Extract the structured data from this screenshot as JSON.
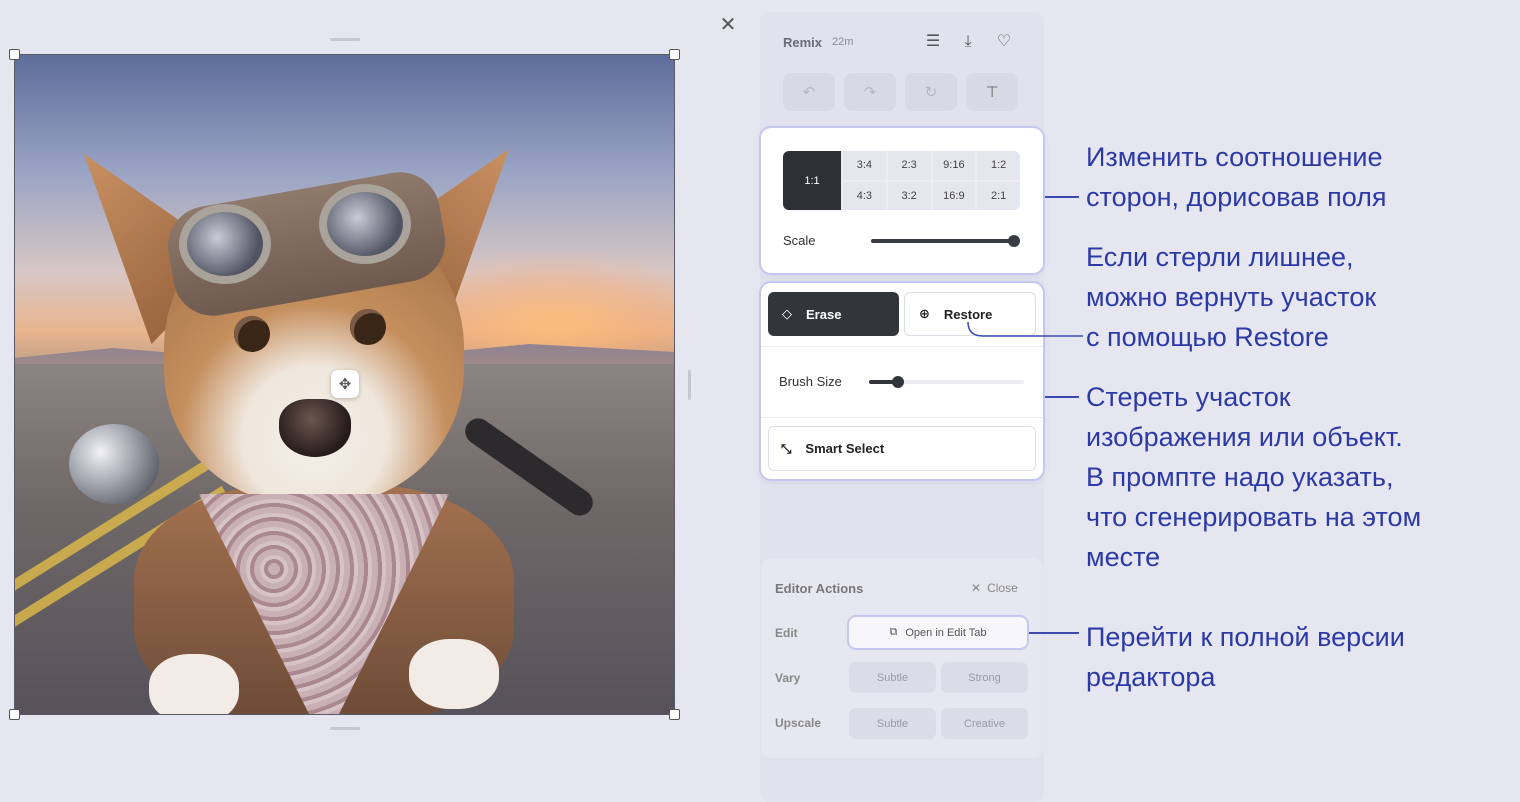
{
  "panel": {
    "title": "Remix",
    "time": "22m"
  },
  "icons": {
    "menu": "menu-lines-icon",
    "download": "download-icon",
    "favorite": "heart-icon",
    "undo": "undo-icon",
    "redo": "redo-icon",
    "reset": "refresh-icon",
    "text": "text-box-icon",
    "close": "close-icon",
    "move": "move-arrows-icon",
    "eraser": "eraser-icon",
    "restore": "plus-circle-icon",
    "smart": "magic-cursor-icon",
    "external": "external-link-icon"
  },
  "aspect": {
    "selected": "1:1",
    "options": [
      "3:4",
      "2:3",
      "9:16",
      "1:2",
      "4:3",
      "3:2",
      "16:9",
      "2:1"
    ],
    "scale_label": "Scale",
    "scale_value": 1.0
  },
  "erase": {
    "erase_label": "Erase",
    "restore_label": "Restore",
    "brush_label": "Brush Size",
    "brush_value": 0.17,
    "smart_label": "Smart Select"
  },
  "actions": {
    "title": "Editor Actions",
    "close_label": "Close",
    "edit_label": "Edit",
    "open_edit_label": "Open in Edit Tab",
    "vary_label": "Vary",
    "upscale_label": "Upscale",
    "subtle": "Subtle",
    "strong": "Strong",
    "creative": "Creative"
  },
  "annotations": {
    "aspect": "Изменить соотношение\nсторон, дорисовав поля",
    "restore": "Если стерли лишнее,\nможно вернуть участок\nс помощью Restore",
    "erase": "Стереть участок\nизображения или объект.\nВ промпте надо указать,\nчто сгенерировать на этом\nместе",
    "editor": "Перейти к полной версии\nредактора"
  },
  "colors": {
    "accent": "#2b3aa6",
    "dark_button": "#33353c"
  }
}
